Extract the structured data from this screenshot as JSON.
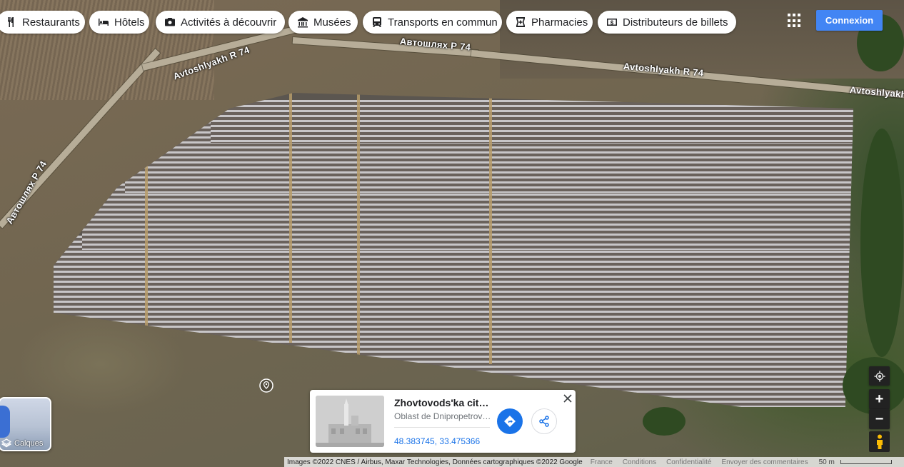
{
  "categories": [
    {
      "label": "Restaurants",
      "icon": "fork-knife-icon"
    },
    {
      "label": "Hôtels",
      "icon": "bed-icon"
    },
    {
      "label": "Activités à découvrir",
      "icon": "camera-icon"
    },
    {
      "label": "Musées",
      "icon": "museum-icon"
    },
    {
      "label": "Transports en commun",
      "icon": "train-icon"
    },
    {
      "label": "Pharmacies",
      "icon": "pharmacy-icon"
    },
    {
      "label": "Distributeurs de billets",
      "icon": "atm-icon"
    }
  ],
  "header": {
    "apps_icon": "apps-grid-icon",
    "signin_label": "Connexion",
    "signin_color": "#4285f4"
  },
  "map": {
    "type": "satellite",
    "road_labels": [
      "Автошлях Р 74",
      "Avtoshlyakh R 74",
      "Автошлях Р 74",
      "Avtoshlyakh R 74",
      "Автошлях Р 74",
      "Avtoshlyakh"
    ]
  },
  "layers": {
    "label": "Calques",
    "icon": "layers-icon"
  },
  "controls": {
    "my_location_icon": "my-location-icon",
    "zoom_in": "+",
    "zoom_out": "−",
    "pegman_icon": "pegman-icon"
  },
  "place_card": {
    "title": "Zhovtovods'ka city ...",
    "subtitle": "Oblast de Dnipropetrovs...",
    "coordinates": "48.383745, 33.475366",
    "directions_icon": "directions-icon",
    "share_icon": "share-icon",
    "close_icon": "close-icon",
    "accent_color": "#1a73e8"
  },
  "footer": {
    "attribution": "Images ©2022 CNES / Airbus, Maxar Technologies, Données cartographiques ©2022 Google",
    "country": "France",
    "terms": "Conditions",
    "privacy": "Confidentialité",
    "feedback": "Envoyer des commentaires",
    "scale": "50 m"
  }
}
